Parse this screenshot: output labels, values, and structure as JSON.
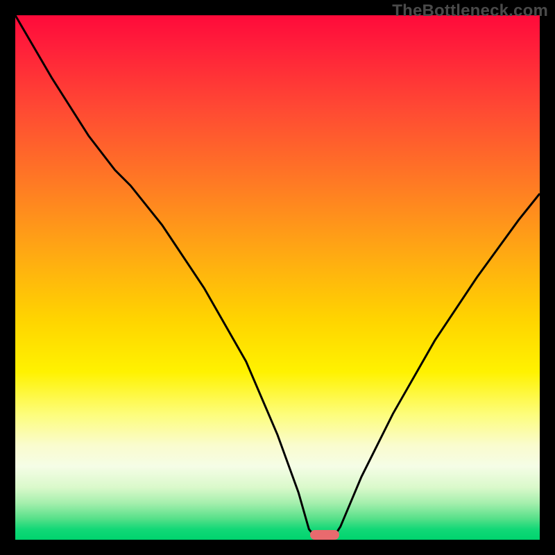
{
  "watermark_text": "TheBottleneck.com",
  "chart_data": {
    "type": "line",
    "title": "",
    "xlabel": "",
    "ylabel": "",
    "xlim": [
      0,
      100
    ],
    "ylim": [
      0,
      100
    ],
    "background": "rainbow-heat-gradient (red top → green bottom)",
    "curve_points": [
      {
        "x": 0.0,
        "y": 100.0
      },
      {
        "x": 7.0,
        "y": 88.0
      },
      {
        "x": 14.0,
        "y": 77.0
      },
      {
        "x": 19.0,
        "y": 70.5
      },
      {
        "x": 22.0,
        "y": 67.5
      },
      {
        "x": 28.0,
        "y": 60.0
      },
      {
        "x": 36.0,
        "y": 48.0
      },
      {
        "x": 44.0,
        "y": 34.0
      },
      {
        "x": 50.0,
        "y": 20.0
      },
      {
        "x": 54.0,
        "y": 9.0
      },
      {
        "x": 56.0,
        "y": 2.0
      },
      {
        "x": 57.5,
        "y": 0.2
      },
      {
        "x": 60.5,
        "y": 0.2
      },
      {
        "x": 62.0,
        "y": 2.5
      },
      {
        "x": 66.0,
        "y": 12.0
      },
      {
        "x": 72.0,
        "y": 24.0
      },
      {
        "x": 80.0,
        "y": 38.0
      },
      {
        "x": 88.0,
        "y": 50.0
      },
      {
        "x": 96.0,
        "y": 61.0
      },
      {
        "x": 100.0,
        "y": 66.0
      }
    ],
    "curve_color": "#000000",
    "curve_stroke_width": 3,
    "marker": {
      "x": 59.0,
      "y": 0.0,
      "color": "#e96a6e",
      "shape": "rounded-bar"
    }
  }
}
